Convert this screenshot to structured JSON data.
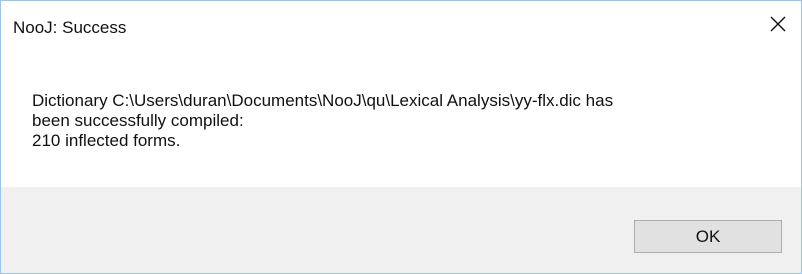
{
  "window": {
    "title": "NooJ: Success",
    "close_icon": "close-icon"
  },
  "message": {
    "line1": "Dictionary C:\\Users\\duran\\Documents\\NooJ\\qu\\Lexical Analysis\\yy-flx.dic has",
    "line2": "been successfully compiled:",
    "line3": "210 inflected forms."
  },
  "buttons": {
    "ok_label": "OK"
  }
}
